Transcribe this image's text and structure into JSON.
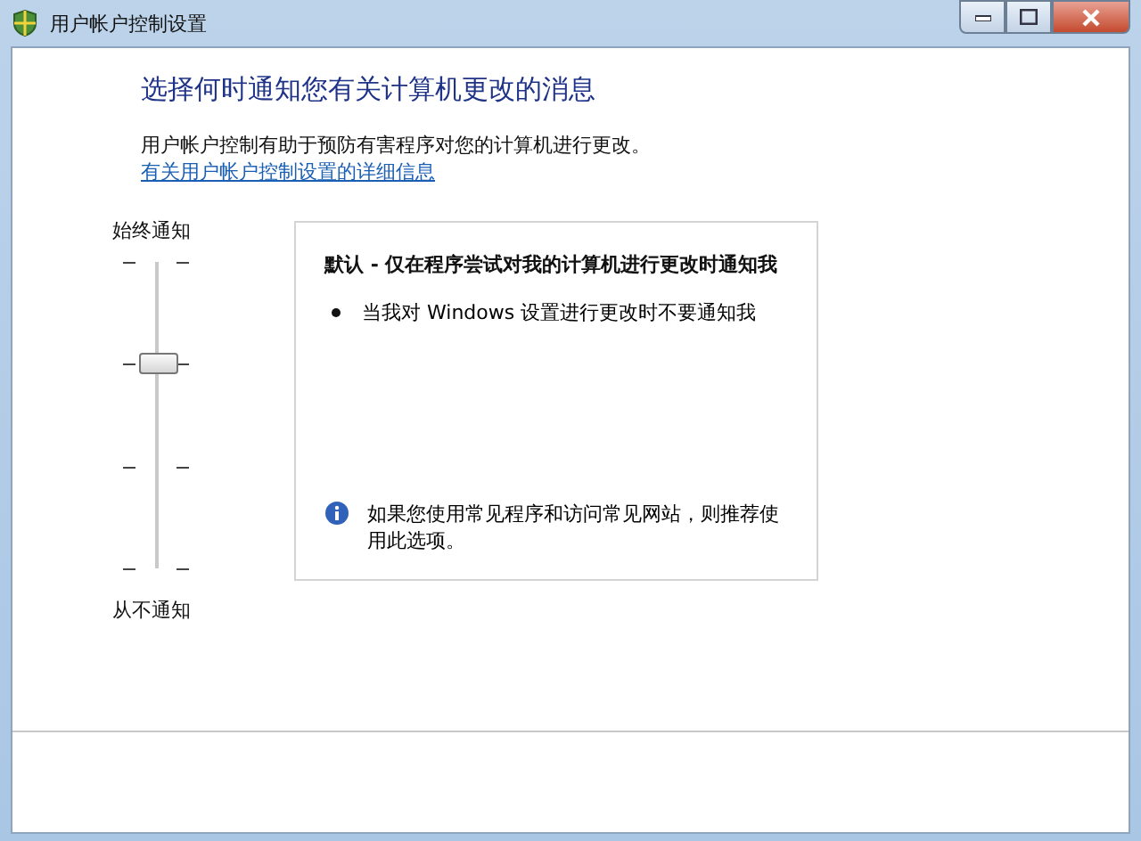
{
  "window": {
    "title": "用户帐户控制设置"
  },
  "heading": "选择何时通知您有关计算机更改的消息",
  "intro": "用户帐户控制有助于预防有害程序对您的计算机进行更改。",
  "details_link": "有关用户帐户控制设置的详细信息",
  "slider": {
    "top_label": "始终通知",
    "bottom_label": "从不通知",
    "level": 0.667
  },
  "description": {
    "title": "默认 - 仅在程序尝试对我的计算机进行更改时通知我",
    "bullets": [
      "当我对 Windows 设置进行更改时不要通知我"
    ],
    "note": "如果您使用常见程序和访问常见网站，则推荐使用此选项。"
  }
}
